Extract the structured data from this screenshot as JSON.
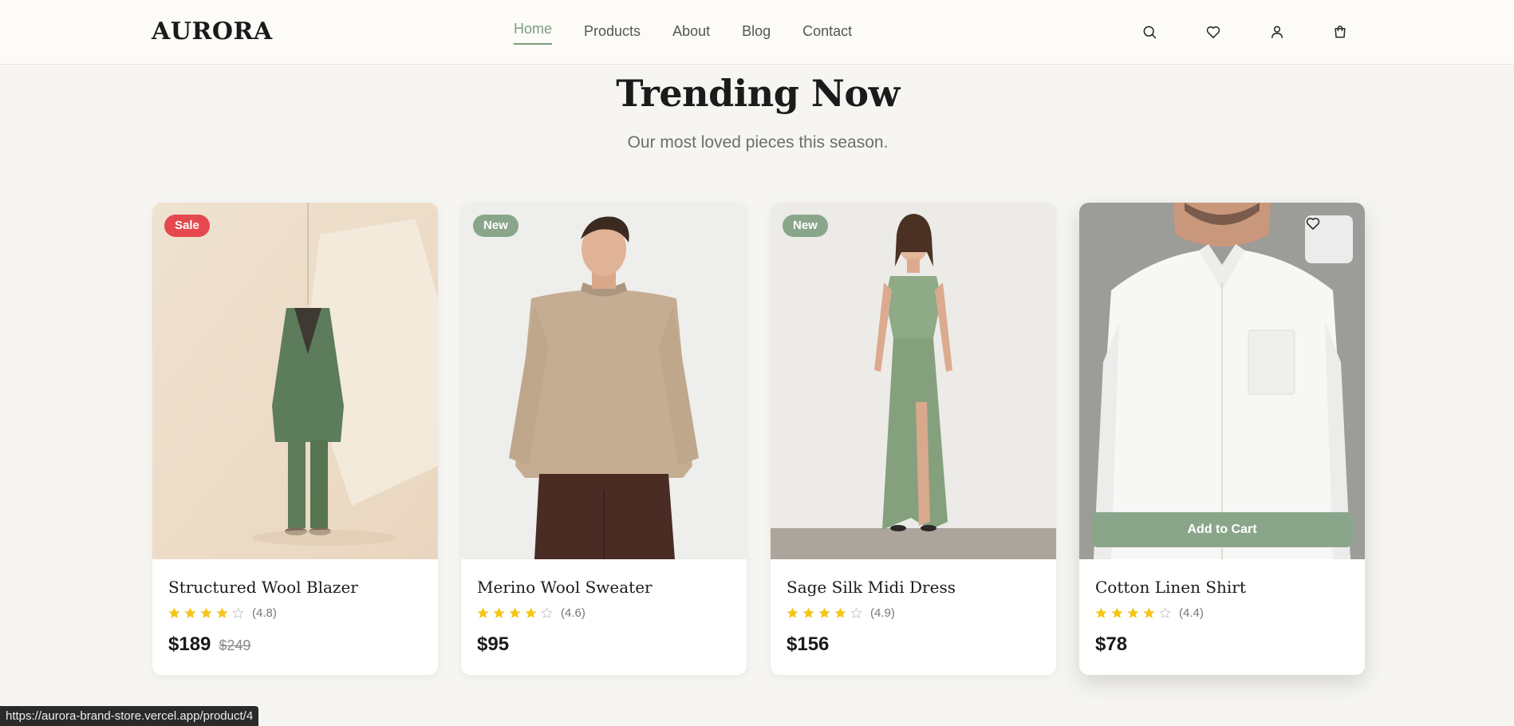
{
  "brand": {
    "logo": "AURORA"
  },
  "nav": {
    "items": [
      {
        "label": "Home",
        "active": true
      },
      {
        "label": "Products",
        "active": false
      },
      {
        "label": "About",
        "active": false
      },
      {
        "label": "Blog",
        "active": false
      },
      {
        "label": "Contact",
        "active": false
      }
    ]
  },
  "header_icons": [
    "search-icon",
    "heart-icon",
    "user-icon",
    "shopping-bag-icon"
  ],
  "section": {
    "title": "Trending Now",
    "subtitle": "Our most loved pieces this season."
  },
  "products": [
    {
      "name": "Structured Wool Blazer",
      "badge": "Sale",
      "badge_type": "sale",
      "stars": 4,
      "rating_text": "(4.8)",
      "price": "$189",
      "old_price": "$249"
    },
    {
      "name": "Merino Wool Sweater",
      "badge": "New",
      "badge_type": "new",
      "stars": 4,
      "rating_text": "(4.6)",
      "price": "$95"
    },
    {
      "name": "Sage Silk Midi Dress",
      "badge": "New",
      "badge_type": "new",
      "stars": 4,
      "rating_text": "(4.9)",
      "price": "$156"
    },
    {
      "name": "Cotton Linen Shirt",
      "stars": 4,
      "rating_text": "(4.4)",
      "price": "$78",
      "hover_cta": "Add to Cart"
    }
  ],
  "status_bar": {
    "url": "https://aurora-brand-store.vercel.app/product/4"
  },
  "colors": {
    "accent": "#7c9d7c",
    "sale": "#e5484d",
    "new": "#8aa68a",
    "star": "#f5c518",
    "background": "#f6f5f1"
  }
}
